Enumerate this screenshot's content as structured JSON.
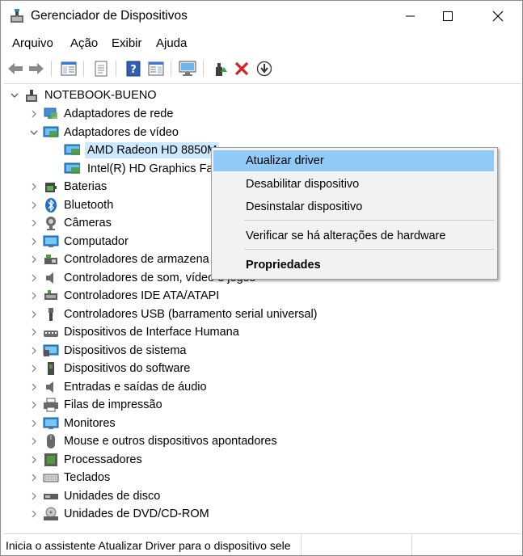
{
  "window": {
    "title": "Gerenciador de Dispositivos"
  },
  "menu": {
    "items": [
      "Arquivo",
      "Ação",
      "Exibir",
      "Ajuda"
    ]
  },
  "toolbar": {
    "icons": [
      "back-arrow-icon",
      "forward-arrow-icon",
      "show-hide-console-tree-icon",
      "properties-icon",
      "help-icon",
      "action-pane-icon",
      "monitor-scan-icon",
      "update-driver-icon",
      "uninstall-x-icon",
      "download-disable-icon"
    ]
  },
  "tree": {
    "root": "NOTEBOOK-BUENO",
    "video_group": "Adaptadores de vídeo",
    "video_children": [
      "AMD Radeon HD 8850M",
      "Intel(R) HD Graphics Far"
    ],
    "categories": [
      "Adaptadores de rede",
      "Baterias",
      "Bluetooth",
      "Câmeras",
      "Computador",
      "Controladores de armazena",
      "Controladores de som, vídeo e jogos",
      "Controladores IDE ATA/ATAPI",
      "Controladores USB (barramento serial universal)",
      "Dispositivos de Interface Humana",
      "Dispositivos de sistema",
      "Dispositivos do software",
      "Entradas e saídas de áudio",
      "Filas de impressão",
      "Monitores",
      "Mouse e outros dispositivos apontadores",
      "Processadores",
      "Teclados",
      "Unidades de disco",
      "Unidades de DVD/CD-ROM"
    ]
  },
  "context_menu": {
    "update": "Atualizar driver",
    "disable": "Desabilitar dispositivo",
    "uninstall": "Desinstalar dispositivo",
    "scan": "Verificar se há alterações de hardware",
    "properties": "Propriedades"
  },
  "status": {
    "text": "Inicia o assistente Atualizar Driver para o dispositivo sele"
  },
  "colors": {
    "selection": "#cce8ff",
    "menu_highlight": "#91c9f7"
  }
}
